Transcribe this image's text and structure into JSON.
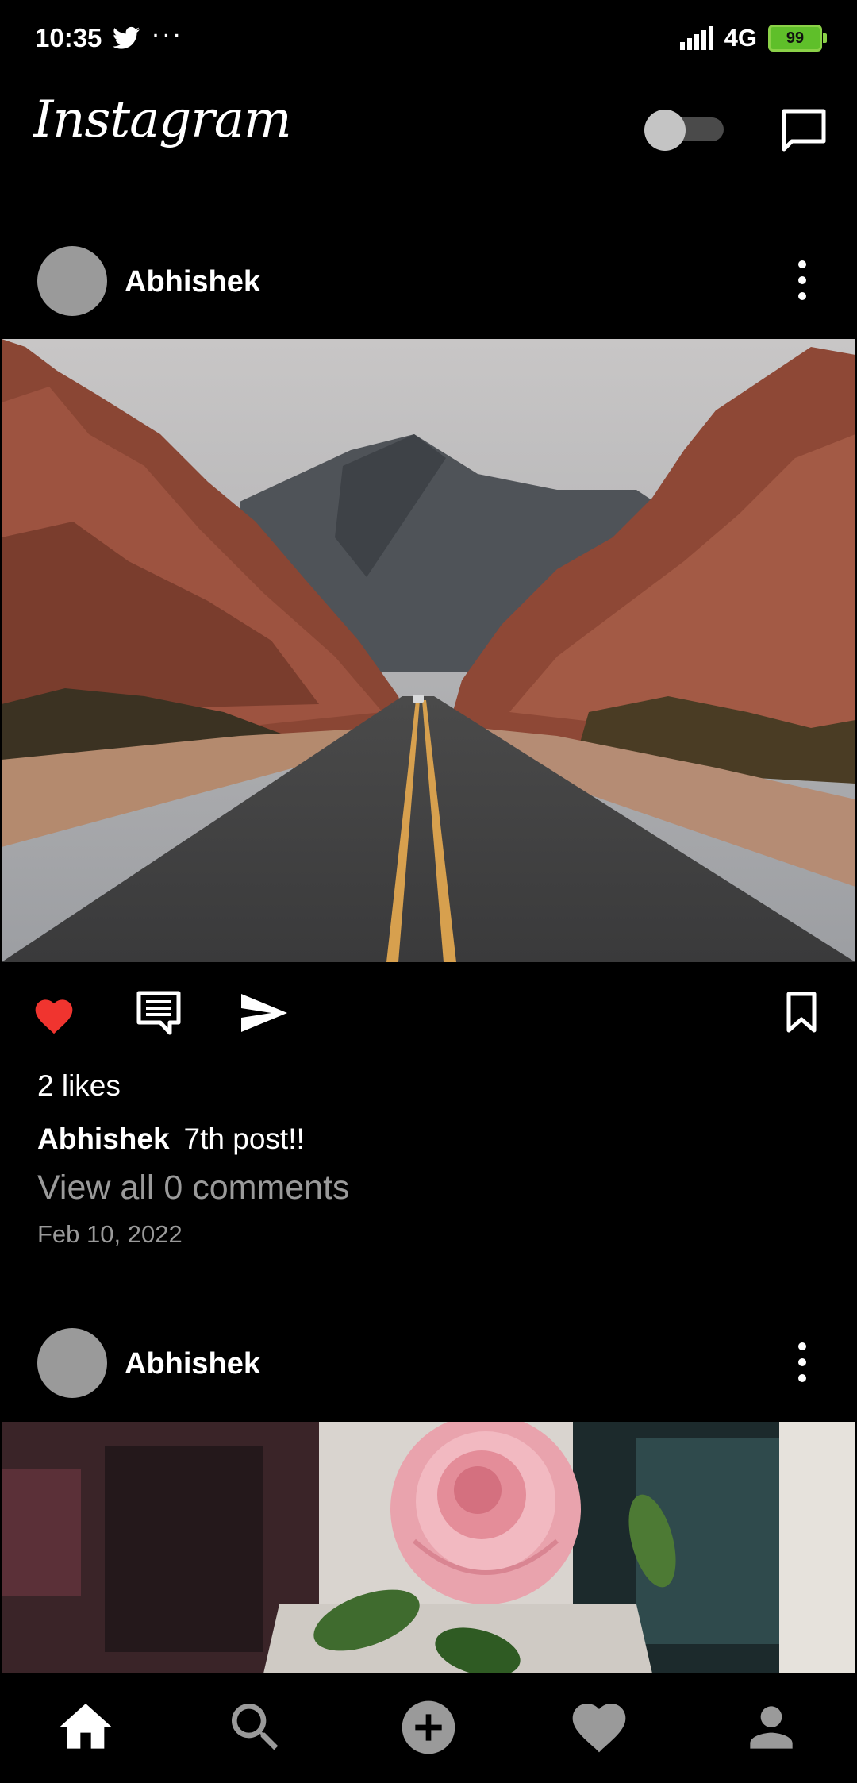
{
  "status_bar": {
    "time": "10:35",
    "more": "···",
    "network": "4G",
    "battery": "99"
  },
  "header": {
    "logo": "Instagram",
    "theme_toggle": "off"
  },
  "posts": [
    {
      "username": "Abhishek",
      "liked": true,
      "likes": "2 likes",
      "caption_user": "Abhishek",
      "caption_text": "7th post!!",
      "view_comments": "View all 0 comments",
      "date": "Feb 10, 2022"
    },
    {
      "username": "Abhishek"
    }
  ],
  "nav": {
    "items": [
      "home-icon",
      "search-icon",
      "add-icon",
      "heart-icon",
      "profile-icon"
    ],
    "active": "home-icon"
  },
  "colors": {
    "background": "#000000",
    "like": "#f0342f",
    "muted_text": "#9a9a9a",
    "avatar": "#9a9a9a",
    "battery": "#5fbf2a"
  }
}
